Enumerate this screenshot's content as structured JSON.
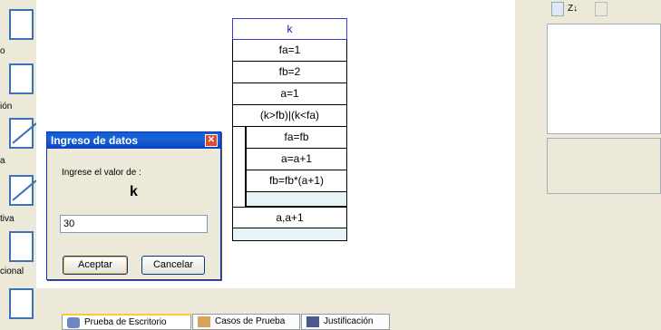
{
  "palette": {
    "labels": [
      "o",
      "ión",
      "a",
      "tiva",
      "cional"
    ]
  },
  "diagram": {
    "header": "k",
    "boxes": [
      "fa=1",
      "fb=2",
      "a=1",
      "(k>fb)|(k<fa)"
    ],
    "loop_body": [
      "fa=fb",
      "a=a+1",
      "fb=fb*(a+1)"
    ],
    "loop_end": "a,a+1"
  },
  "dialog": {
    "title": "Ingreso de datos",
    "close_symbol": "✕",
    "prompt": "Ingrese el valor de :",
    "variable": "k",
    "input_value": "30",
    "ok_label": "Aceptar",
    "cancel_label": "Cancelar"
  },
  "properties_toolbar": {
    "sort_label": "Z↓"
  },
  "tabs": [
    {
      "label": "Prueba de Escritorio",
      "icon": "desk-test-icon"
    },
    {
      "label": "Casos de Prueba",
      "icon": "test-cases-icon"
    },
    {
      "label": "Justificación",
      "icon": "justification-icon"
    }
  ]
}
